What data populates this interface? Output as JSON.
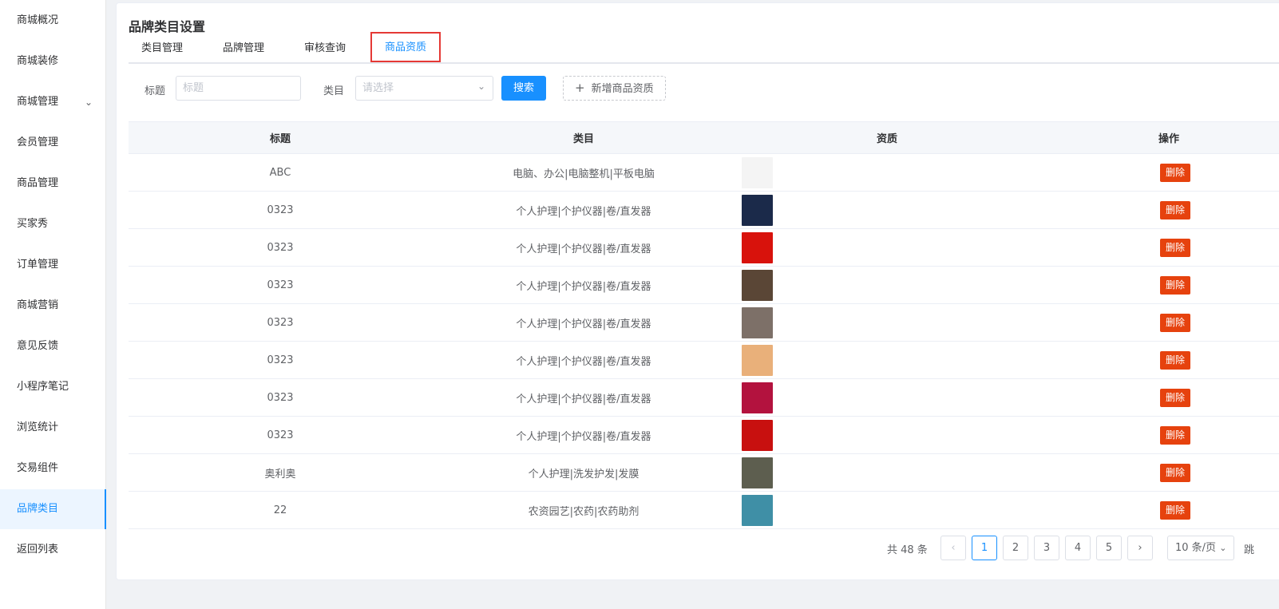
{
  "sidebar": {
    "items": [
      {
        "label": "商城概况"
      },
      {
        "label": "商城装修"
      },
      {
        "label": "商城管理",
        "has_submenu": true
      },
      {
        "label": "会员管理"
      },
      {
        "label": "商品管理"
      },
      {
        "label": "买家秀"
      },
      {
        "label": "订单管理"
      },
      {
        "label": "商城营销"
      },
      {
        "label": "意见反馈"
      },
      {
        "label": "小程序笔记"
      },
      {
        "label": "浏览统计"
      },
      {
        "label": "交易组件"
      },
      {
        "label": "品牌类目",
        "active": true
      },
      {
        "label": "返回列表"
      }
    ]
  },
  "page": {
    "title": "品牌类目设置"
  },
  "tabs": [
    {
      "label": "类目管理"
    },
    {
      "label": "品牌管理"
    },
    {
      "label": "审核查询"
    },
    {
      "label": "商品资质",
      "active": true
    }
  ],
  "filter": {
    "title_label": "标题",
    "title_placeholder": "标题",
    "category_label": "类目",
    "category_placeholder": "请选择",
    "search_button": "搜索",
    "add_button": "新增商品资质"
  },
  "table": {
    "columns": [
      "标题",
      "类目",
      "资质",
      "操作"
    ],
    "delete_label": "删除",
    "rows": [
      {
        "title": "ABC",
        "category": "电脑、办公|电脑整机|平板电脑",
        "thumb_color": "#f4f4f4"
      },
      {
        "title": "0323",
        "category": "个人护理|个护仪器|卷/直发器",
        "thumb_color": "#1b2a4a"
      },
      {
        "title": "0323",
        "category": "个人护理|个护仪器|卷/直发器",
        "thumb_color": "#d8120c"
      },
      {
        "title": "0323",
        "category": "个人护理|个护仪器|卷/直发器",
        "thumb_color": "#5a4636"
      },
      {
        "title": "0323",
        "category": "个人护理|个护仪器|卷/直发器",
        "thumb_color": "#7d7068"
      },
      {
        "title": "0323",
        "category": "个人护理|个护仪器|卷/直发器",
        "thumb_color": "#e9b07a"
      },
      {
        "title": "0323",
        "category": "个人护理|个护仪器|卷/直发器",
        "thumb_color": "#b3123e"
      },
      {
        "title": "0323",
        "category": "个人护理|个护仪器|卷/直发器",
        "thumb_color": "#c8100f"
      },
      {
        "title": "奥利奥",
        "category": "个人护理|洗发护发|发膜",
        "thumb_color": "#5d5e4f"
      },
      {
        "title": "22",
        "category": "农资园艺|农药|农药助剂",
        "thumb_color": "#3f8fa6"
      }
    ]
  },
  "pagination": {
    "total_text": "共 48 条",
    "prev": "‹",
    "next": "›",
    "pages": [
      "1",
      "2",
      "3",
      "4",
      "5"
    ],
    "current": "1",
    "page_size": "10 条/页",
    "jump_label": "跳"
  },
  "colors": {
    "accent": "#1890ff",
    "danger": "#e6420e",
    "highlight_border": "#e53935"
  }
}
